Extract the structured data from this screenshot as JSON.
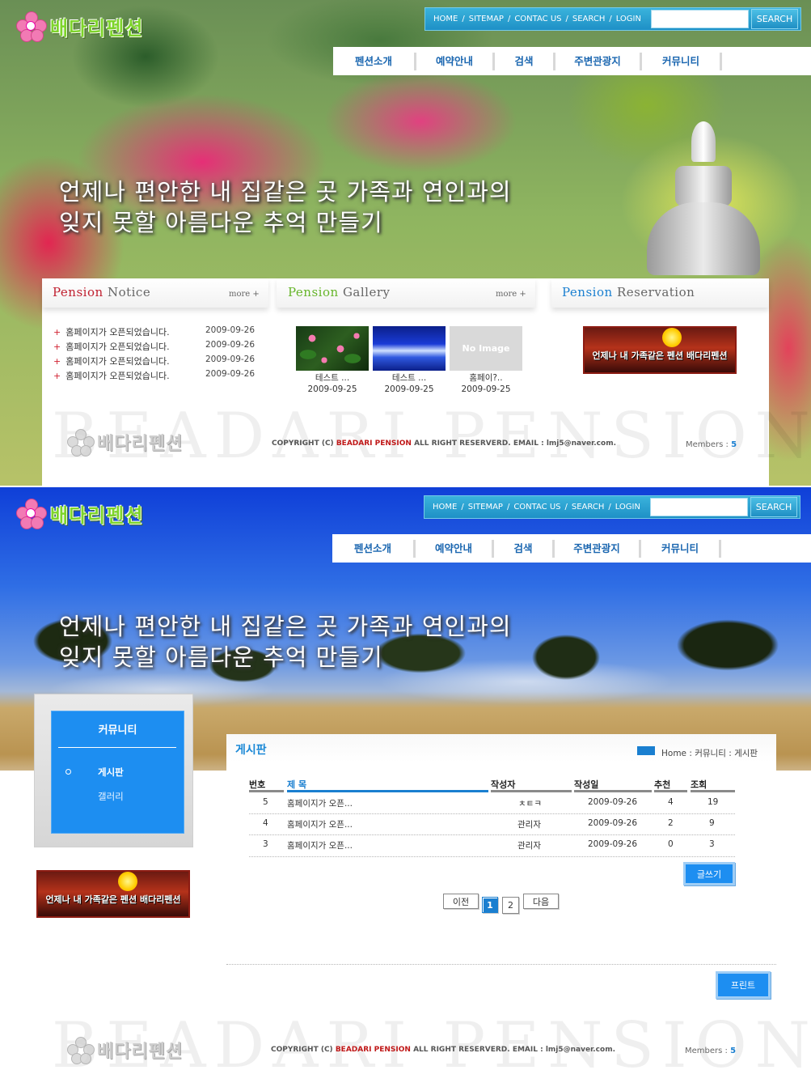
{
  "brand": {
    "logo_text": "배다리펜션",
    "accent": "#1a7fd0",
    "nav_bg": "#1e90c6"
  },
  "topnav": {
    "items": [
      "HOME",
      "SITEMAP",
      "CONTAC US",
      "SEARCH",
      "LOGIN"
    ],
    "sep": "/",
    "search_placeholder": "",
    "search_button": "SEARCH"
  },
  "mainmenu": [
    "펜션소개",
    "예약안내",
    "검색",
    "주변관광지",
    "커뮤니티"
  ],
  "slogan": {
    "line1": "언제나 편안한 내 집같은 곳 가족과 연인과의",
    "line2": "잊지 못할 아름다운 추억 만들기"
  },
  "home": {
    "notice": {
      "title_a": "Pension",
      "title_b": "Notice",
      "more": "more +",
      "bullet": "+",
      "items": [
        {
          "title": "홈페이지가 오픈되었습니다.",
          "date": "2009-09-26"
        },
        {
          "title": "홈페이지가 오픈되었습니다.",
          "date": "2009-09-26"
        },
        {
          "title": "홈페이지가 오픈되었습니다.",
          "date": "2009-09-26"
        },
        {
          "title": "홈페이지가 오픈되었습니다.",
          "date": "2009-09-26"
        }
      ]
    },
    "gallery": {
      "title_a": "Pension",
      "title_b": "Gallery",
      "more": "more +",
      "no_image": "No Image",
      "items": [
        {
          "caption": "테스트 ...",
          "date": "2009-09-25",
          "thumb": "lily-pond"
        },
        {
          "caption": "테스트 ...",
          "date": "2009-09-25",
          "thumb": "blue-wave"
        },
        {
          "caption": "홈페이?..",
          "date": "2009-09-25",
          "thumb": "no-image"
        }
      ]
    },
    "reservation": {
      "title_a": "Pension",
      "title_b": "Reservation",
      "banner_text": "언제나 내 가족같은 펜션 배다리펜션"
    }
  },
  "footer": {
    "watermark": "BEADARI PENSION",
    "copy_pre": "COPYRIGHT (C)",
    "copy_brand": "BEADARI PENSION",
    "copy_post": "ALL RIGHT RESERVERD. EMAIL : lmj5@naver.com.",
    "members_label": "Members :",
    "members_count": "5"
  },
  "sub": {
    "side": {
      "title": "커뮤니티",
      "items": [
        "게시판",
        "갤러리"
      ],
      "banner_text": "언제나 내 가족같은 펜션 배다리펜션"
    },
    "board": {
      "title": "게시판",
      "breadcrumb": "Home : 커뮤니티 : 게시판",
      "columns": [
        "번호",
        "제    목",
        "작성자",
        "작성일",
        "추천",
        "조회"
      ],
      "rows": [
        {
          "no": "5",
          "subject": "홈페이지가 오픈...",
          "writer": "ㅊㅌㅋ",
          "date": "2009-09-26",
          "rec": "4",
          "views": "19"
        },
        {
          "no": "4",
          "subject": "홈페이지가 오픈...",
          "writer": "관리자",
          "date": "2009-09-26",
          "rec": "2",
          "views": "9"
        },
        {
          "no": "3",
          "subject": "홈페이지가 오픈...",
          "writer": "관리자",
          "date": "2009-09-26",
          "rec": "0",
          "views": "3"
        }
      ],
      "write_button": "글쓰기",
      "pagination": {
        "prev": "이전",
        "pages": [
          "1",
          "2"
        ],
        "current": "1",
        "next": "다음"
      },
      "print_button": "프린트"
    }
  }
}
